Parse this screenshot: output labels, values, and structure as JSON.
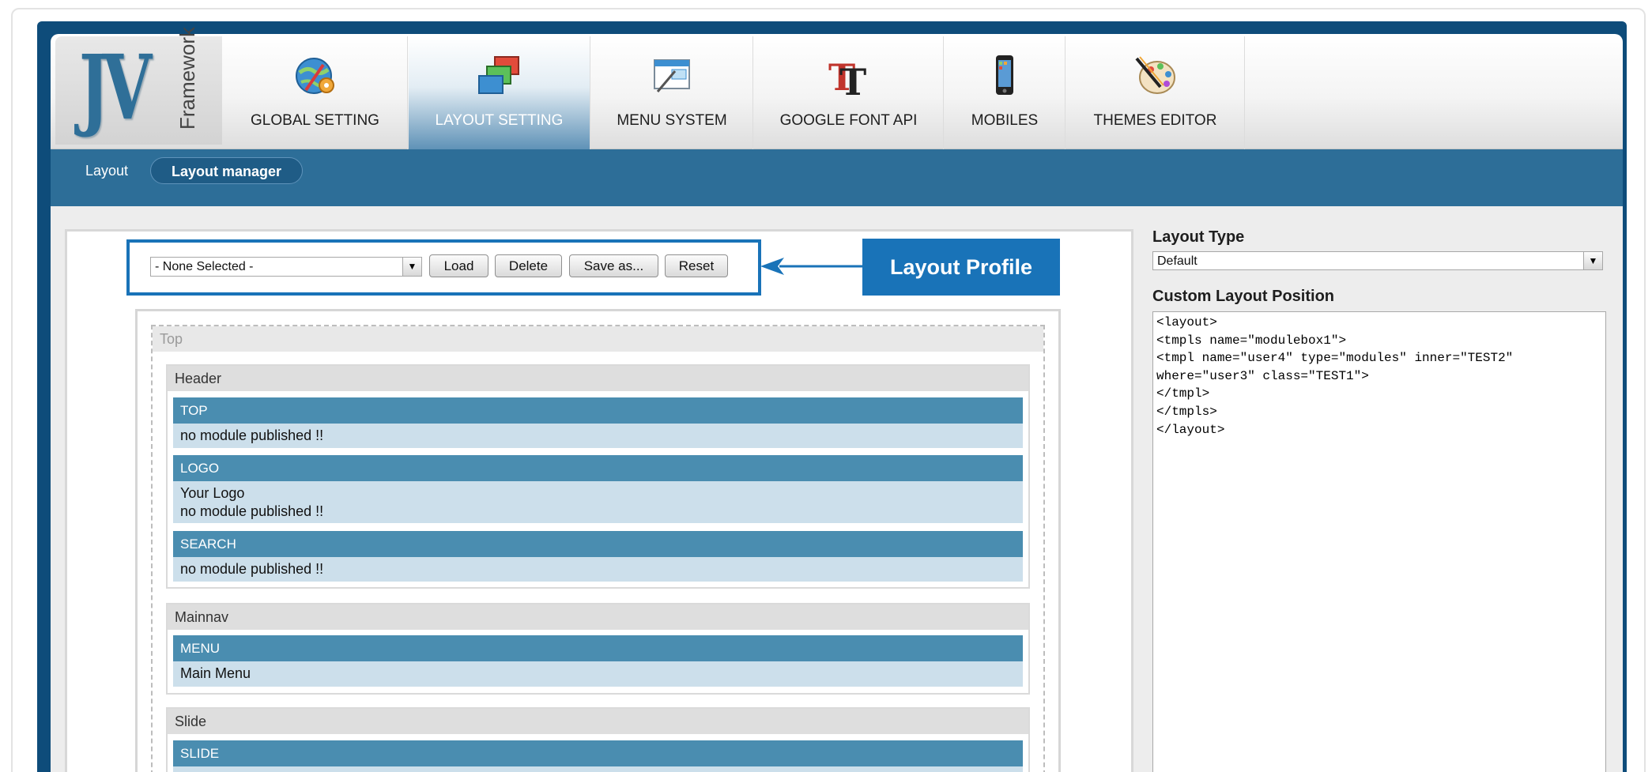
{
  "app": {
    "logo_letters": "JV",
    "logo_word": "Framework"
  },
  "tabs": [
    {
      "label": "GLOBAL SETTING",
      "icon": "globe-gear-icon"
    },
    {
      "label": "LAYOUT SETTING",
      "icon": "layers-icon",
      "active": true
    },
    {
      "label": "MENU SYSTEM",
      "icon": "menu-window-icon"
    },
    {
      "label": "GOOGLE FONT API",
      "icon": "font-icon"
    },
    {
      "label": "MOBILES",
      "icon": "mobile-phone-icon"
    },
    {
      "label": "THEMES EDITOR",
      "icon": "palette-brush-icon"
    }
  ],
  "subnav": [
    {
      "label": "Layout"
    },
    {
      "label": "Layout manager",
      "active": true
    }
  ],
  "profile": {
    "select_value": "- None Selected -",
    "buttons": {
      "load": "Load",
      "delete": "Delete",
      "save_as": "Save as...",
      "reset": "Reset"
    },
    "callout": "Layout Profile"
  },
  "layout": {
    "top_label": "Top",
    "groups": [
      {
        "title": "Header",
        "modules": [
          {
            "name": "TOP",
            "lines": [
              "no module published !!"
            ]
          },
          {
            "name": "LOGO",
            "lines": [
              "Your Logo",
              "no module published !!"
            ]
          },
          {
            "name": "SEARCH",
            "lines": [
              "no module published !!"
            ]
          }
        ]
      },
      {
        "title": "Mainnav",
        "modules": [
          {
            "name": "MENU",
            "lines": [
              "Main Menu"
            ]
          }
        ]
      },
      {
        "title": "Slide",
        "modules": [
          {
            "name": "SLIDE",
            "lines": []
          }
        ]
      }
    ]
  },
  "right": {
    "layout_type_label": "Layout Type",
    "layout_type_value": "Default",
    "custom_position_label": "Custom Layout Position",
    "custom_position_code": "<layout>\n<tmpls name=\"modulebox1\">\n<tmpl name=\"user4\" type=\"modules\" inner=\"TEST2\"\nwhere=\"user3\" class=\"TEST1\">\n</tmpl>\n</tmpls>\n</layout>"
  },
  "colors": {
    "frame_blue": "#0e4c7a",
    "nav_blue": "#2d6e98",
    "module_head": "#4a8db0",
    "module_body": "#ccdfeb",
    "callout_blue": "#1973b8"
  }
}
